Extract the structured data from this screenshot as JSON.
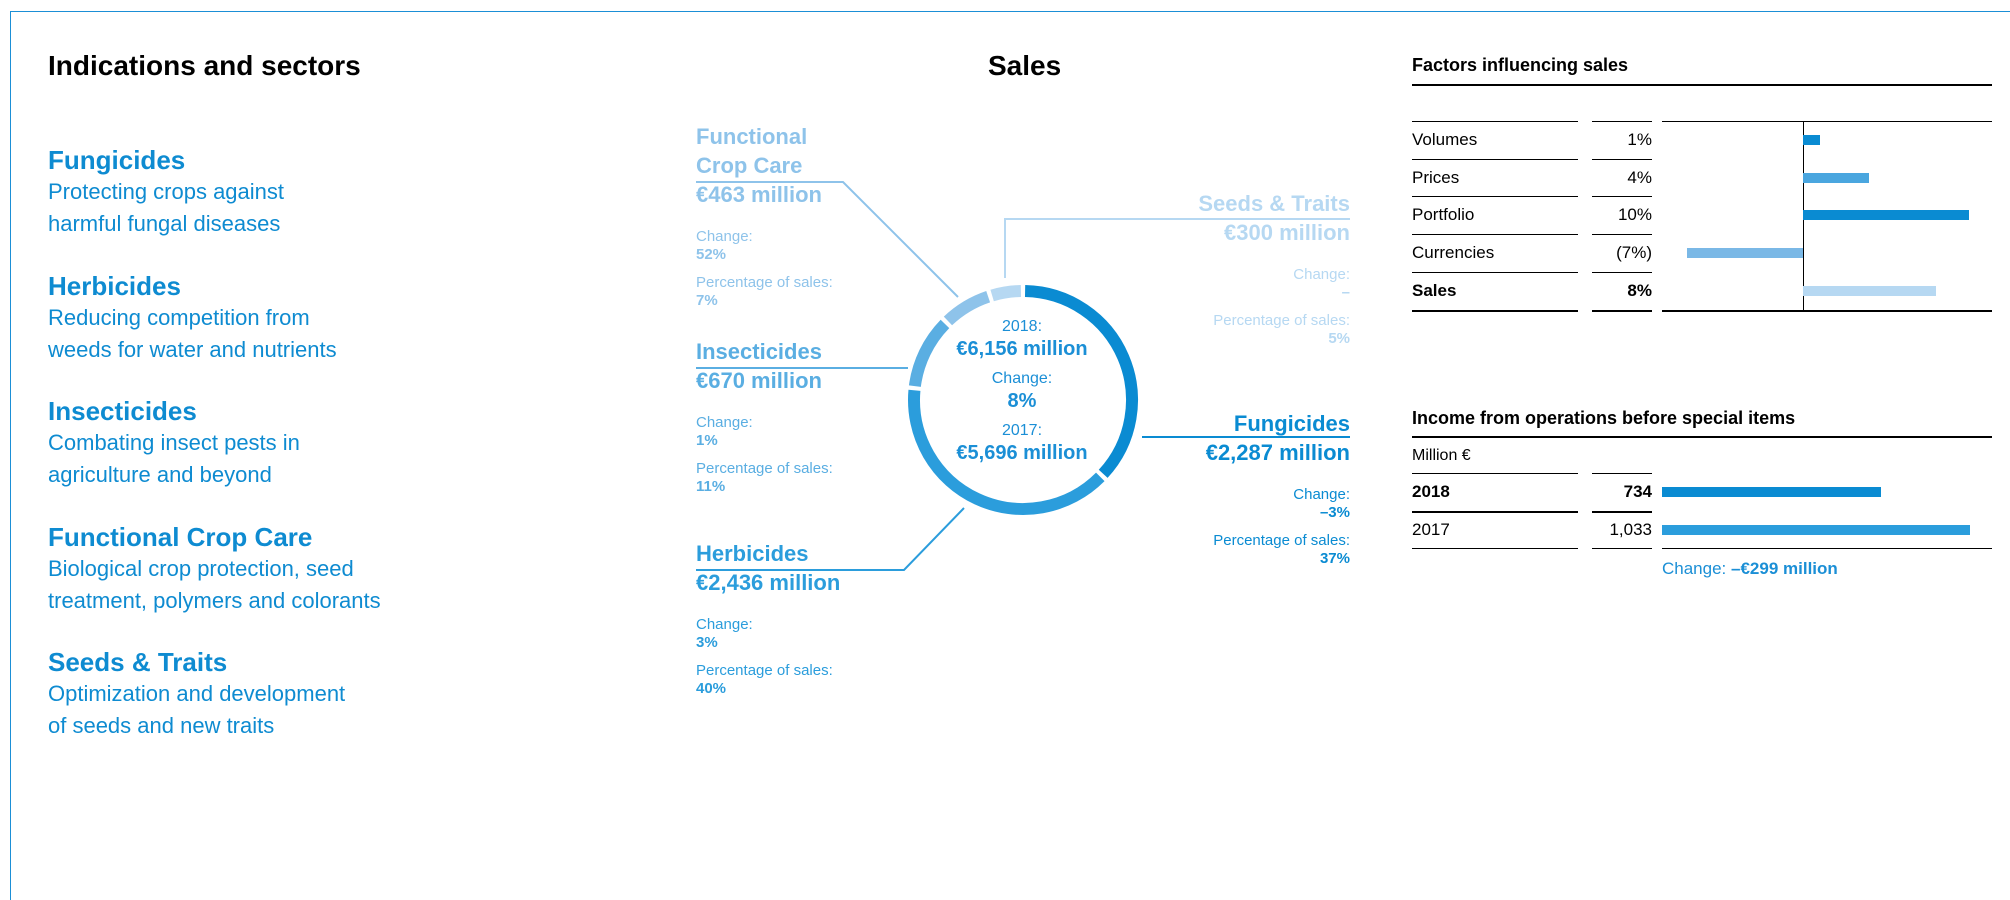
{
  "headings": {
    "indications": "Indications and sectors",
    "sales": "Sales"
  },
  "indications": [
    {
      "title": "Fungicides",
      "desc": "Protecting crops against\nharmful fungal diseases"
    },
    {
      "title": "Herbicides",
      "desc": "Reducing competition from\nweeds for water and nutrients"
    },
    {
      "title": "Insecticides",
      "desc": "Combating insect pests in\nagriculture and beyond"
    },
    {
      "title": "Functional Crop Care",
      "desc": "Biological crop protection, seed\ntreatment, polymers and colorants"
    },
    {
      "title": "Seeds & Traits",
      "desc": "Optimization and development\nof seeds and new traits"
    }
  ],
  "change_label": "Change:",
  "share_label": "Percentage of sales:",
  "segments": {
    "fcc": {
      "name": "Functional\nCrop Care",
      "amount": "€463 million",
      "change": "52%",
      "share": "7%"
    },
    "seeds": {
      "name": "Seeds & Traits",
      "amount": "€300 million",
      "change": "–",
      "share": "5%"
    },
    "insecticides": {
      "name": "Insecticides",
      "amount": "€670 million",
      "change": "1%",
      "share": "11%"
    },
    "fungicides": {
      "name": "Fungicides",
      "amount": "€2,287 million",
      "change": "–3%",
      "share": "37%"
    },
    "herbicides": {
      "name": "Herbicides",
      "amount": "€2,436 million",
      "change": "3%",
      "share": "40%"
    }
  },
  "donut_center": {
    "y2018_label": "2018:",
    "y2018_value": "€6,156 million",
    "change_label": "Change:",
    "change_value": "8%",
    "y2017_label": "2017:",
    "y2017_value": "€5,696 million"
  },
  "colors": {
    "fungicides": "#0a8bd2",
    "herbicides": "#2b9ddc",
    "insecticides": "#5aaee2",
    "fcc": "#8ec3ea",
    "seeds": "#b6d8f2",
    "prices": "#4aa6df",
    "currencies": "#7ab8e6"
  },
  "chart_data": [
    {
      "type": "pie",
      "title": "Sales",
      "categories": [
        "Fungicides",
        "Herbicides",
        "Insecticides",
        "Functional Crop Care",
        "Seeds & Traits"
      ],
      "values": [
        2287,
        2436,
        670,
        463,
        300
      ],
      "unit": "€ million"
    },
    {
      "type": "bar",
      "title": "Factors influencing sales",
      "categories": [
        "Volumes",
        "Prices",
        "Portfolio",
        "Currencies",
        "Sales"
      ],
      "values": [
        1,
        4,
        10,
        -7,
        8
      ],
      "labels": [
        "1%",
        "4%",
        "10%",
        "(7%)",
        "8%"
      ],
      "unit": "%"
    },
    {
      "type": "bar",
      "title": "Income from operations before special items",
      "ylabel": "Million €",
      "categories": [
        "2018",
        "2017"
      ],
      "values": [
        734,
        1033
      ],
      "labels": [
        "734",
        "1,033"
      ],
      "change_label": "Change:",
      "change_value": "–€299 million"
    }
  ]
}
